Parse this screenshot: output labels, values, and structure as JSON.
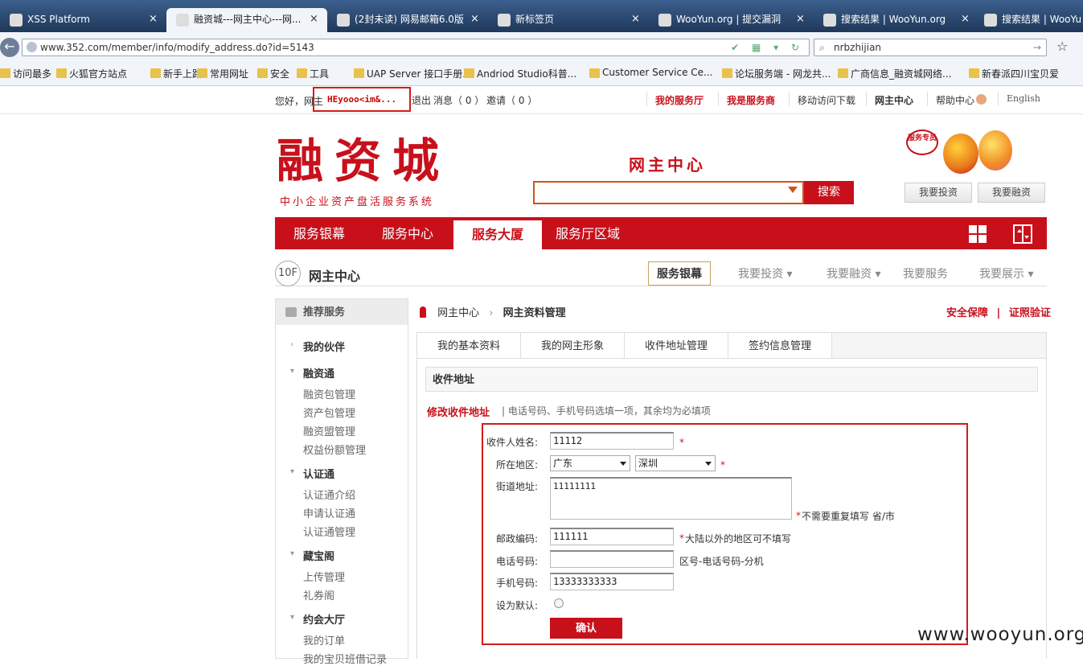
{
  "browser": {
    "tabs": [
      {
        "title": "XSS Platform",
        "close": "×"
      },
      {
        "title": "融资城---网主中心---网...",
        "close": "×"
      },
      {
        "title": "(2封未读) 网易邮箱6.0版",
        "close": "×"
      },
      {
        "title": "新标签页",
        "close": "×"
      },
      {
        "title": "WooYun.org | 提交漏洞",
        "close": "×"
      },
      {
        "title": "搜索结果 | WooYun.org",
        "close": "×"
      },
      {
        "title": "搜索结果 | WooYu",
        "close": ""
      }
    ],
    "url": "www.352.com/member/info/modify_address.do?id=5143",
    "search_value": "nrbzhijian",
    "bookmarks": [
      "访问最多",
      "火狐官方站点",
      "新手上路",
      "常用网址",
      "安全",
      "工具",
      "UAP Server 接口手册...",
      "Andriod Studio科普...",
      "Customer Service Ce...",
      "论坛服务端 - 网龙共...",
      "广商信息_融资城网络...",
      "新春派四川宝贝爱"
    ]
  },
  "topbar": {
    "greeting": "您好，网主",
    "username": "HEyooo<im&...",
    "logout": "退出",
    "messages": "消息（ 0 ）",
    "invite": "邀请（ 0 ）",
    "links": [
      "我的服务厅",
      "我是服务商",
      "移动访问下载",
      "网主中心",
      "帮助中心",
      "English"
    ]
  },
  "header": {
    "logo": "融资城",
    "logo_sub": "中小企业资产盘活服务系统",
    "center_title": "网主中心",
    "search_button": "搜索",
    "mascot_badge": "服务专员",
    "invest_button": "我要投资",
    "finance_button": "我要融资"
  },
  "mainnav": [
    "服务银幕",
    "服务中心",
    "服务大厦",
    "服务厅区域"
  ],
  "subbar": {
    "floor": "10F",
    "title": "网主中心",
    "items": [
      "服务银幕",
      "我要投资 ▾",
      "我要融资 ▾",
      "我要服务",
      "我要展示 ▾"
    ]
  },
  "sidebar": {
    "header": "推荐服务",
    "groups": [
      {
        "label": "我的伙伴",
        "arrow": "›",
        "items": []
      },
      {
        "label": "融资通",
        "arrow": "▾",
        "items": [
          "融资包管理",
          "资产包管理",
          "融资盟管理",
          "权益份额管理"
        ]
      },
      {
        "label": "认证通",
        "arrow": "▾",
        "items": [
          "认证通介绍",
          "申请认证通",
          "认证通管理"
        ]
      },
      {
        "label": "藏宝阁",
        "arrow": "▾",
        "items": [
          "上传管理",
          "礼券阁"
        ]
      },
      {
        "label": "约会大厅",
        "arrow": "▾",
        "items": [
          "我的订单",
          "我的宝贝班借记录"
        ]
      }
    ]
  },
  "breadcrumb": {
    "home": "网主中心",
    "sep": "›",
    "current": "网主资料管理"
  },
  "right_links": {
    "a": "安全保障",
    "sep": "|",
    "b": "证照验证"
  },
  "page_tabs": [
    "我的基本资料",
    "我的网主形象",
    "收件地址管理",
    "签约信息管理"
  ],
  "section_title": "收件地址",
  "form": {
    "title": "修改收件地址",
    "hint": "| 电话号码、手机号码选填一项，其余均为必填项",
    "name_label": "收件人姓名:",
    "name_value": "11112",
    "region_label": "所在地区:",
    "province": "广东",
    "city": "深圳",
    "street_label": "街道地址:",
    "street_value": "11111111",
    "street_note": "不需要重复填写 省/市",
    "zip_label": "邮政编码:",
    "zip_value": "111111",
    "zip_note": "大陆以外的地区可不填写",
    "phone_label": "电话号码:",
    "phone_value": "",
    "phone_note": "区号-电话号码-分机",
    "mobile_label": "手机号码:",
    "mobile_value": "13333333333",
    "default_label": "设为默认:",
    "confirm": "确认",
    "required_mark": "*"
  },
  "watermark": "www.wooyun.org"
}
